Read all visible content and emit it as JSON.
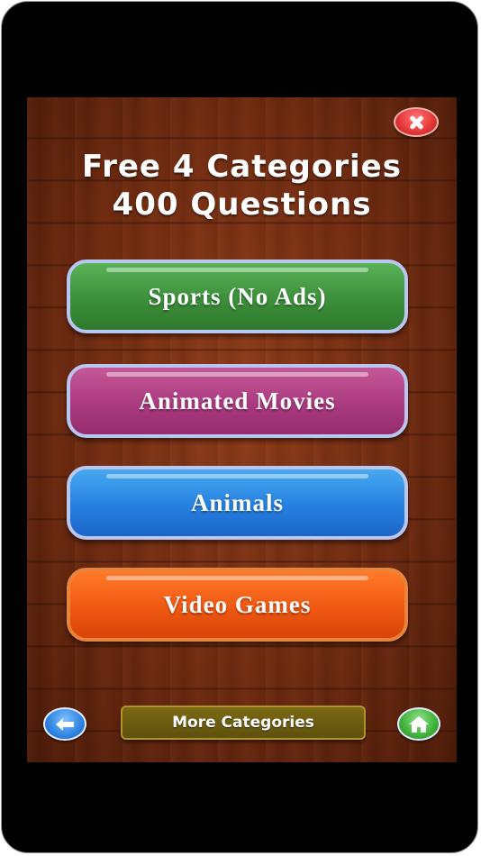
{
  "header": {
    "line1": "Free 4 Categories",
    "line2": "400 Questions"
  },
  "categories": [
    {
      "label": "Sports (No Ads)",
      "color": "#3c8f3a"
    },
    {
      "label": "Animated Movies",
      "color": "#ab3a80"
    },
    {
      "label": "Animals",
      "color": "#2580e0"
    },
    {
      "label": "Video Games",
      "color": "#f05812"
    }
  ],
  "footer": {
    "more_label": "More Categories"
  },
  "icons": {
    "close": "close-icon",
    "back": "back-arrow-icon",
    "home": "home-icon"
  }
}
